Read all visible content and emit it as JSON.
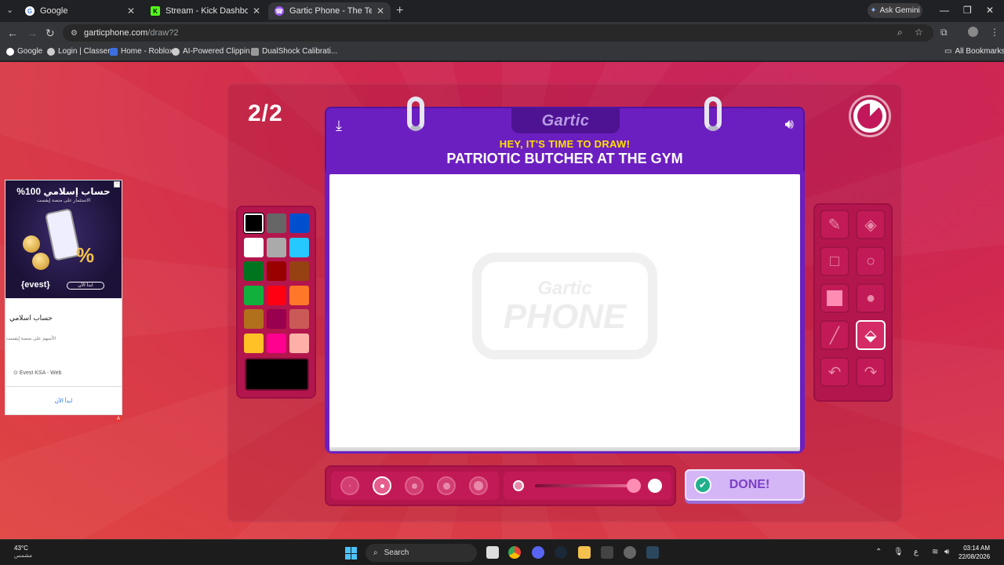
{
  "browser": {
    "tabs": [
      {
        "title": "Google",
        "icon": "google-icon",
        "color": "#ffffff"
      },
      {
        "title": "Stream - Kick Dashboard",
        "icon": "kick-icon",
        "color": "#53fc18"
      },
      {
        "title": "Gartic Phone - The Telephone G",
        "icon": "gartic-icon",
        "color": "#9b59f0"
      }
    ],
    "ask_gemini": "Ask Gemini",
    "url_host": "garticphone.com",
    "url_path": "/draw?2",
    "bookmarks": [
      {
        "label": "Google"
      },
      {
        "label": "Login | Classera"
      },
      {
        "label": "Home - Roblox"
      },
      {
        "label": "AI-Powered Clippin..."
      },
      {
        "label": "DualShock Calibrati..."
      }
    ],
    "all_bookmarks": "All Bookmarks"
  },
  "game": {
    "round": "2/2",
    "brand": "Gartic",
    "subtitle": "HEY, IT'S TIME TO DRAW!",
    "prompt": "PATRIOTIC BUTCHER AT THE GYM",
    "watermark_top": "Gartic",
    "watermark_bottom": "PHONE",
    "timer_remaining_fraction": 0.875,
    "palette": [
      "#000000",
      "#666666",
      "#0050cd",
      "#ffffff",
      "#aaaaaa",
      "#26c9ff",
      "#017420",
      "#990000",
      "#964112",
      "#11b03c",
      "#ff0013",
      "#ff7829",
      "#b0701c",
      "#99004e",
      "#cb5a57",
      "#ffc126",
      "#ff008f",
      "#feafa8"
    ],
    "selected_color": "#000000",
    "tools": [
      {
        "name": "pencil-tool",
        "glyph": "✎"
      },
      {
        "name": "eraser-tool",
        "glyph": "◈"
      },
      {
        "name": "rectangle-tool",
        "glyph": "□"
      },
      {
        "name": "ellipse-tool",
        "glyph": "○"
      },
      {
        "name": "filled-rectangle-tool",
        "glyph": ""
      },
      {
        "name": "filled-ellipse-tool",
        "glyph": "●"
      },
      {
        "name": "line-tool",
        "glyph": "╱"
      },
      {
        "name": "fill-bucket-tool",
        "glyph": "⬙"
      },
      {
        "name": "undo-tool",
        "glyph": "↶"
      },
      {
        "name": "redo-tool",
        "glyph": "↷"
      }
    ],
    "selected_tool": "fill-bucket-tool",
    "brush_sizes": 5,
    "selected_size_index": 1,
    "opacity_level": 0.97,
    "done_label": "DONE!"
  },
  "ad": {
    "headline": "حساب إسلامي 100%",
    "subline": "الاستثمار على منصة إيفست",
    "logo": "{evest}",
    "cta_image": "ابدأ الآن",
    "title": "حساب اسلامي",
    "description": "الأسهم على منصة إيفست",
    "source": "Evest KSA - Web",
    "link": "ابدأ الآن"
  },
  "taskbar": {
    "temperature": "43°C",
    "condition": "مشمس",
    "search": "Search",
    "time": "03:14 AM",
    "date": "22/08/2026",
    "lang": "ع"
  }
}
